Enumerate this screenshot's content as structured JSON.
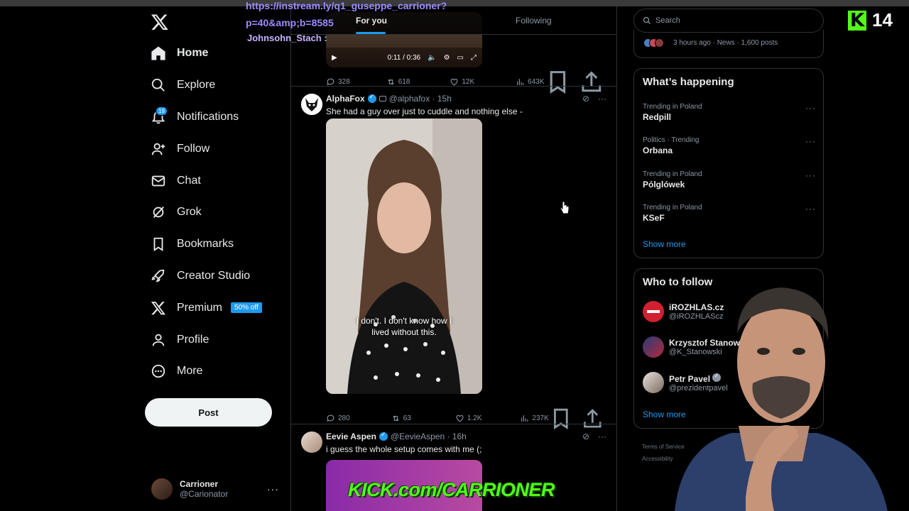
{
  "overlay": {
    "url_line1": "https://instream.ly/q1_guseppe_carrioner?",
    "url_line2": "p=40&amp;b=8585",
    "chat_user": "Johnsohn_Stach :"
  },
  "nav": {
    "items": [
      {
        "label": "Home",
        "icon": "home-icon",
        "active": true
      },
      {
        "label": "Explore",
        "icon": "search-icon"
      },
      {
        "label": "Notifications",
        "icon": "bell-icon",
        "badge": "19"
      },
      {
        "label": "Follow",
        "icon": "person-plus-icon"
      },
      {
        "label": "Chat",
        "icon": "envelope-icon"
      },
      {
        "label": "Grok",
        "icon": "grok-icon"
      },
      {
        "label": "Bookmarks",
        "icon": "bookmark-icon"
      },
      {
        "label": "Creator Studio",
        "icon": "rocket-icon"
      },
      {
        "label": "Premium",
        "icon": "x-icon",
        "badge": "50% off"
      },
      {
        "label": "Profile",
        "icon": "person-icon"
      },
      {
        "label": "More",
        "icon": "more-circle-icon"
      }
    ],
    "post_label": "Post"
  },
  "account": {
    "name": "Carrioner",
    "handle": "@Carionator",
    "dots": "···"
  },
  "tabs": {
    "for_you": "For you",
    "following": "Following"
  },
  "top_video": {
    "time": "0:11 / 0:36"
  },
  "top_actions": {
    "replies": "328",
    "reposts": "618",
    "likes": "12K",
    "views": "643K"
  },
  "tweet1": {
    "name": "AlphaFox",
    "handle": "@alphafox · 15h",
    "text": "She had a guy over just to cuddle and nothing else -",
    "caption_line1": "I don't. I don't know how I",
    "caption_line2": "lived without this.",
    "replies": "280",
    "reposts": "63",
    "likes": "1.2K",
    "views": "237K"
  },
  "tweet2": {
    "name": "Eevie Aspen",
    "handle": "@EevieAspen · 16h",
    "text": "i guess the whole setup comes with me (;"
  },
  "search": {
    "placeholder": "Search"
  },
  "news": {
    "meta": "3 hours ago · News · 1,600 posts"
  },
  "happening": {
    "title": "What’s happening",
    "trends": [
      {
        "context": "Trending in Poland",
        "topic": "Redpill"
      },
      {
        "context": "Politics · Trending",
        "topic": "Orbana"
      },
      {
        "context": "Trending in Poland",
        "topic": "Pólglówek"
      },
      {
        "context": "Trending in Poland",
        "topic": "KSeF"
      }
    ],
    "show_more": "Show more"
  },
  "who_to_follow": {
    "title": "Who to follow",
    "people": [
      {
        "name": "iROZHLAS.cz",
        "handle": "@iROZHLAScz"
      },
      {
        "name": "Krzysztof Stanowski",
        "handle": "@K_Stanowski"
      },
      {
        "name": "Petr Pavel",
        "handle": "@prezidentpavel"
      }
    ],
    "show_more": "Show more"
  },
  "footer": {
    "line1": "Terms of Service",
    "line2": "Accessibility"
  },
  "kick": {
    "viewers": "14",
    "banner": "KICK.com/CARRIONER"
  },
  "colors": {
    "accent": "#1d9bf0",
    "kick_green": "#53fc18",
    "overlay_purple": "#9b8bff"
  }
}
